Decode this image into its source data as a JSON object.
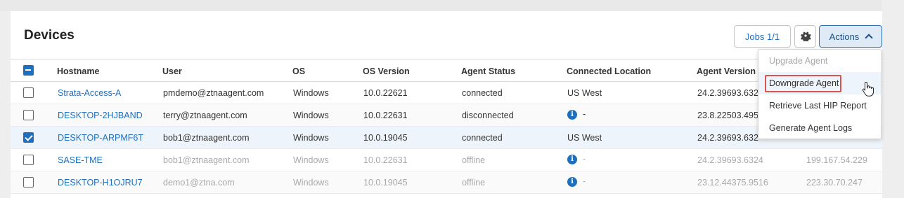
{
  "page": {
    "title": "Devices",
    "jobs_label": "Jobs 1/1",
    "actions_label": "Actions"
  },
  "table": {
    "columns": [
      "Hostname",
      "User",
      "OS",
      "OS Version",
      "Agent Status",
      "Connected Location",
      "Agent Version"
    ],
    "rows": [
      {
        "hostname": "Strata-Access-A",
        "user": "pmdemo@ztnaagent.com",
        "os": "Windows",
        "os_version": "10.0.22621",
        "agent_status": "connected",
        "location": "US West",
        "agent_version": "24.2.39693.632",
        "location_info": false,
        "checked": false,
        "dim": false
      },
      {
        "hostname": "DESKTOP-2HJBAND",
        "user": "terry@ztnaagent.com",
        "os": "Windows",
        "os_version": "10.0.22631",
        "agent_status": "disconnected",
        "location": "-",
        "agent_version": "23.8.22503.495",
        "location_info": true,
        "checked": false,
        "dim": false
      },
      {
        "hostname": "DESKTOP-ARPMF6T",
        "user": "bob1@ztnaagent.com",
        "os": "Windows",
        "os_version": "10.0.19045",
        "agent_status": "connected",
        "location": "US West",
        "agent_version": "24.2.39693.632",
        "location_info": false,
        "checked": true,
        "dim": false
      },
      {
        "hostname": "SASE-TME",
        "user": "bob1@ztnaagent.com",
        "os": "Windows",
        "os_version": "10.0.22631",
        "agent_status": "offline",
        "location": "-",
        "agent_version": "24.2.39693.6324",
        "ip": "199.167.54.229",
        "location_info": true,
        "checked": false,
        "dim": true
      },
      {
        "hostname": "DESKTOP-H1OJRU7",
        "user": "demo1@ztna.com",
        "os": "Windows",
        "os_version": "10.0.19045",
        "agent_status": "offline",
        "location": "-",
        "agent_version": "23.12.44375.9516",
        "ip": "223.30.70.247",
        "location_info": true,
        "checked": false,
        "dim": true
      }
    ]
  },
  "actions_menu": {
    "items": [
      "Upgrade Agent",
      "Downgrade Agent",
      "Retrieve Last HIP Report",
      "Generate Agent Logs"
    ],
    "disabled": [
      "Upgrade Agent"
    ],
    "highlighted": "Downgrade Agent"
  },
  "icons": {
    "settings": "gear-icon",
    "actions_chevron": "chevron-up-icon",
    "info": "info-icon",
    "cursor": "hand-pointer-icon"
  },
  "colors": {
    "accent": "#1f6fbf",
    "highlight_border": "#d9534f",
    "selected_row": "#eef4fb"
  }
}
